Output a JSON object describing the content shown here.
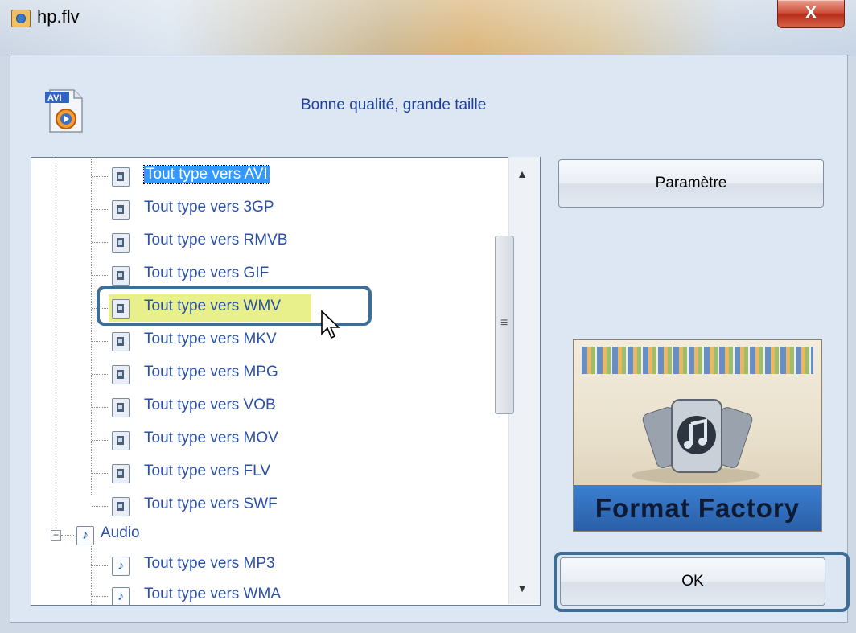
{
  "window": {
    "title": "hp.flv",
    "close_label": "X"
  },
  "profile": {
    "quality_label": "Bonne qualité, grande taille",
    "icon_label": "AVI"
  },
  "tree": {
    "video_items": [
      {
        "label": "Tout type vers AVI",
        "selected": true
      },
      {
        "label": "Tout type vers 3GP"
      },
      {
        "label": "Tout type vers RMVB"
      },
      {
        "label": "Tout type vers GIF"
      },
      {
        "label": "Tout type vers WMV",
        "hovered": true
      },
      {
        "label": "Tout type vers MKV"
      },
      {
        "label": "Tout type vers MPG"
      },
      {
        "label": "Tout type vers VOB"
      },
      {
        "label": "Tout type vers MOV"
      },
      {
        "label": "Tout type vers FLV"
      },
      {
        "label": "Tout type vers SWF"
      }
    ],
    "audio_group": {
      "label": "Audio",
      "expander": "−",
      "items": [
        {
          "label": "Tout type vers MP3"
        },
        {
          "label": "Tout type vers WMA"
        }
      ]
    }
  },
  "scrollbar": {
    "up_arrow": "▲",
    "down_arrow": "▼",
    "grip": "≡"
  },
  "buttons": {
    "settings_label": "Paramètre",
    "ok_label": "OK"
  },
  "logo": {
    "text": "Format Factory"
  }
}
